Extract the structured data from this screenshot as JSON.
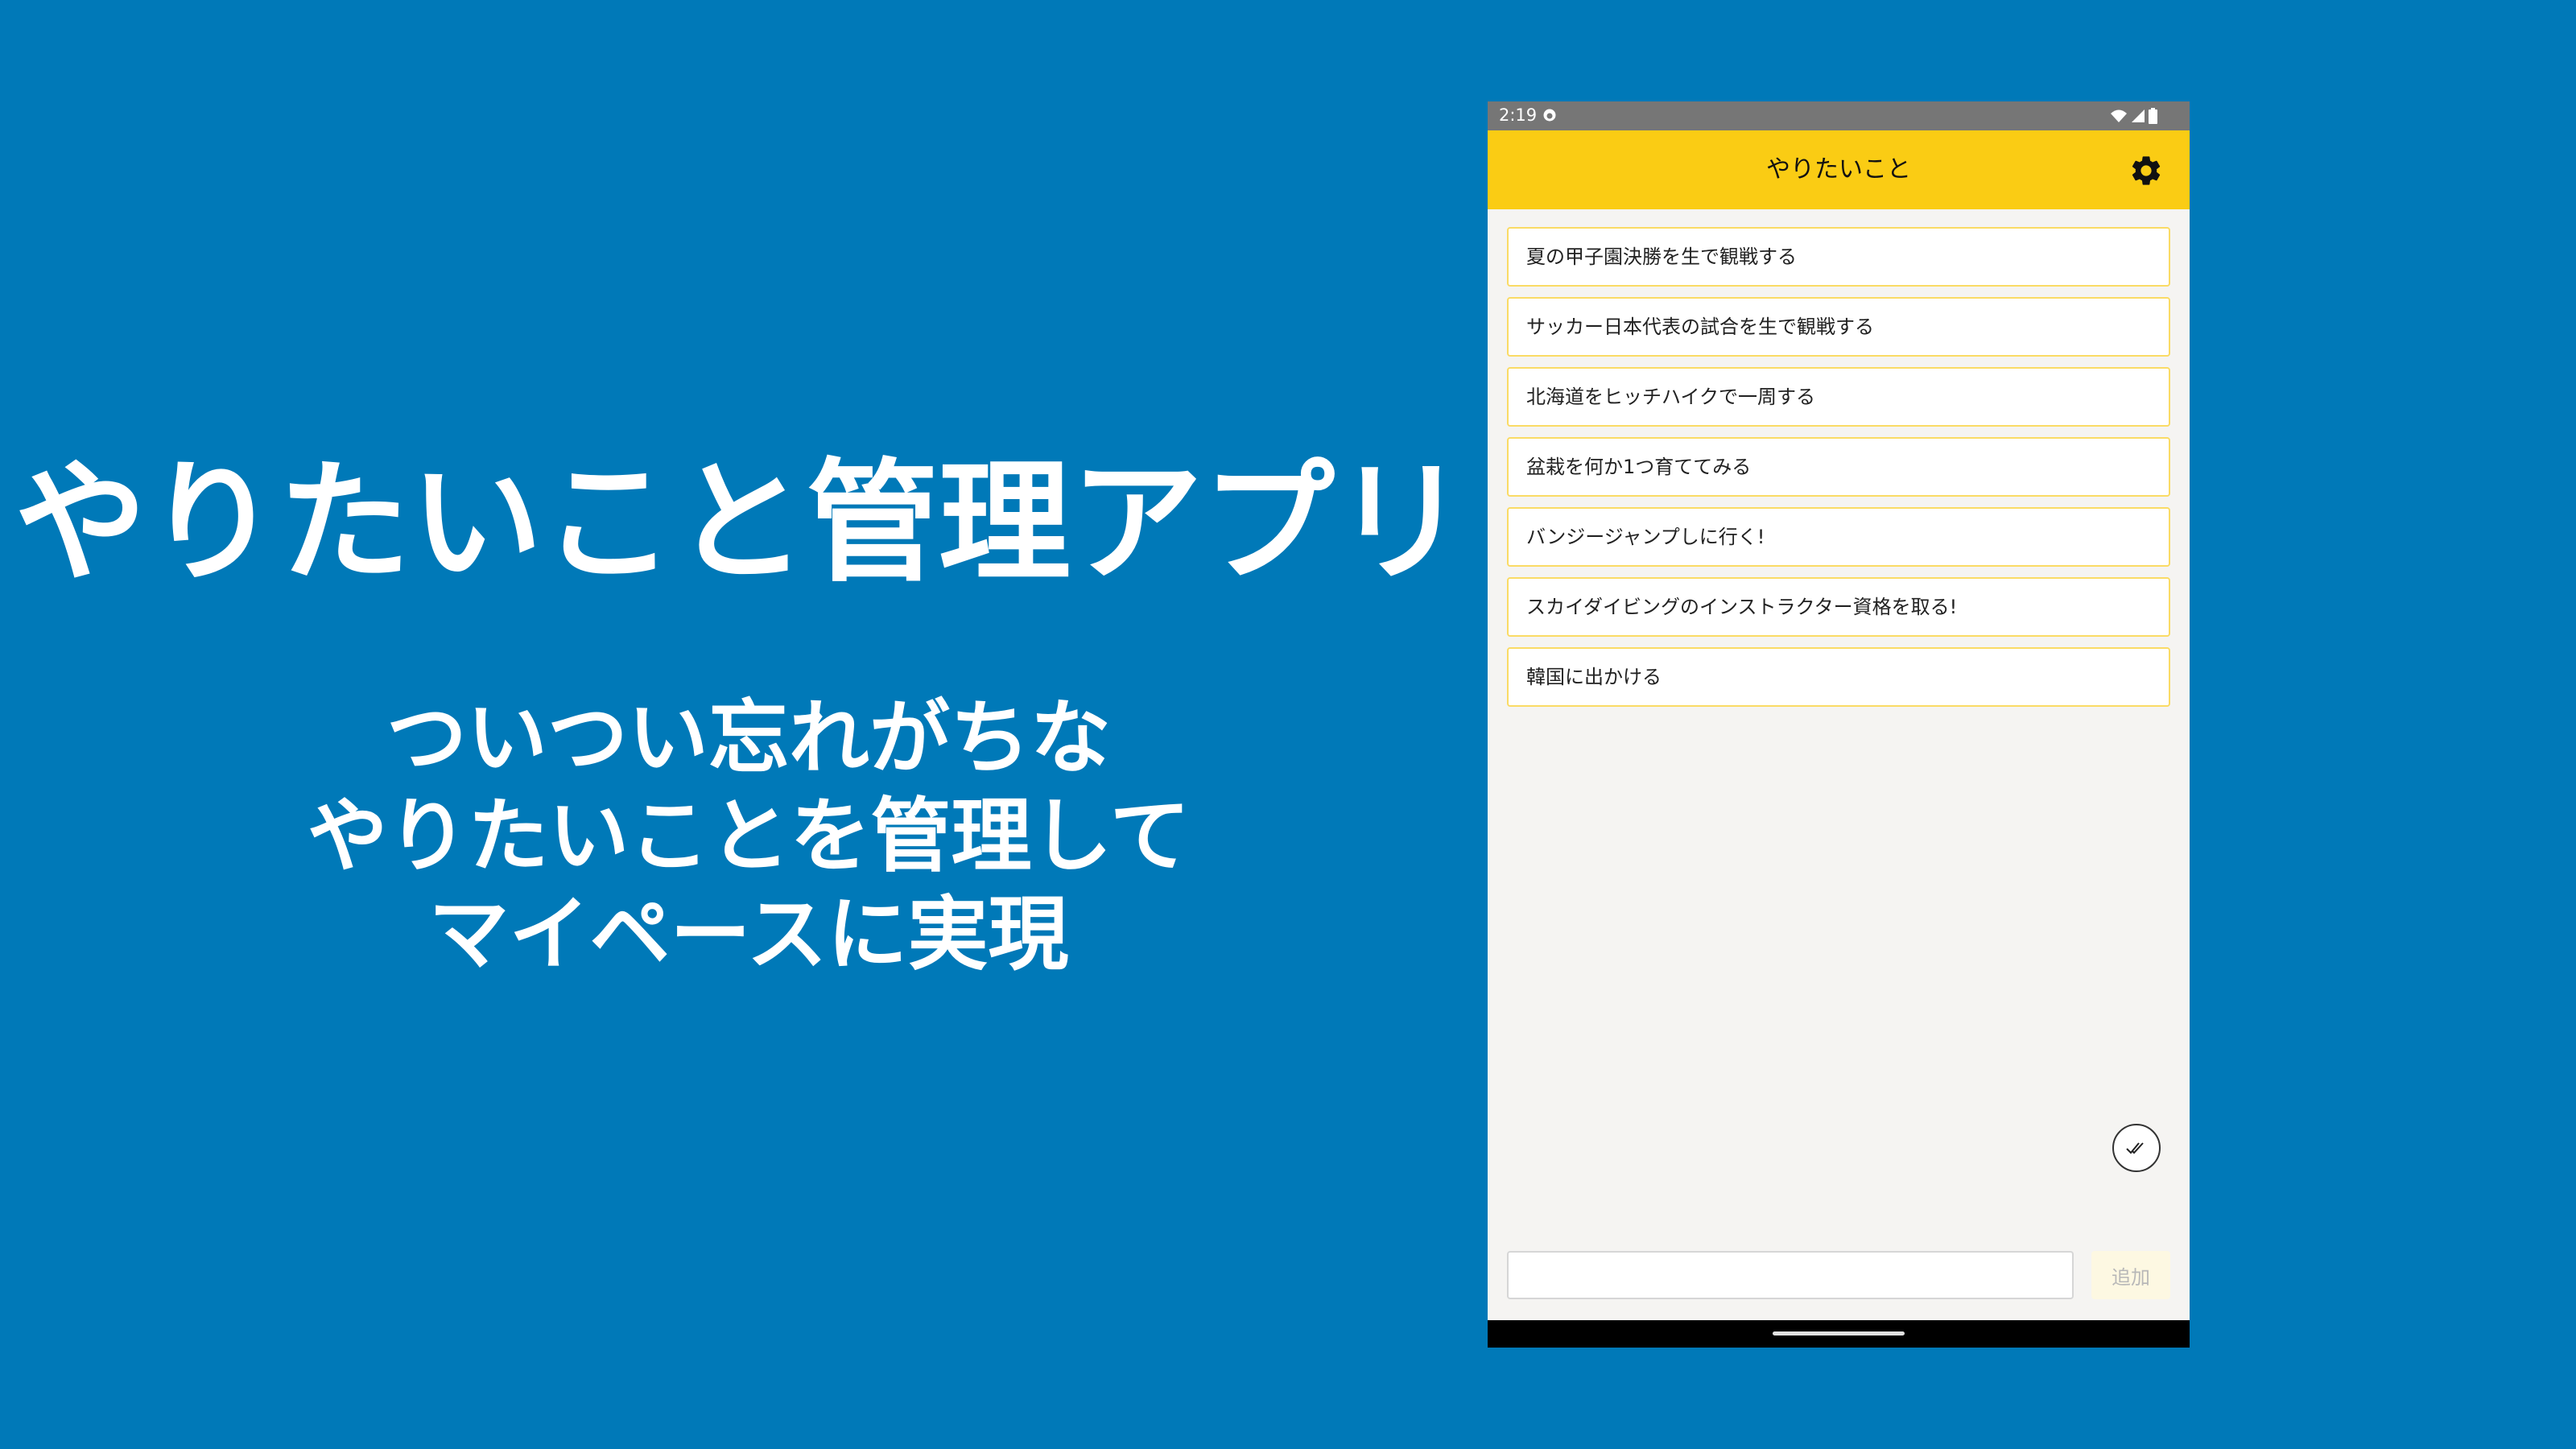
{
  "promo": {
    "title": "やりたいこと管理アプリ",
    "subtitle_lines": [
      "ついつい忘れがちな",
      "やりたいことを管理して",
      "マイペースに実現"
    ]
  },
  "status_bar": {
    "time": "2:19"
  },
  "app_bar": {
    "title": "やりたいこと"
  },
  "todo_items": [
    "夏の甲子園決勝を生で観戦する",
    "サッカー日本代表の試合を生で観戦する",
    "北海道をヒッチハイクで一周する",
    "盆栽を何か1つ育ててみる",
    "バンジージャンプしに行く!",
    "スカイダイビングのインストラクター資格を取る!",
    "韓国に出かける"
  ],
  "input": {
    "value": "",
    "add_label": "追加"
  },
  "colors": {
    "background": "#0079b8",
    "app_bar": "#facc14",
    "item_border": "#fadb65",
    "status_bar": "#767676"
  }
}
